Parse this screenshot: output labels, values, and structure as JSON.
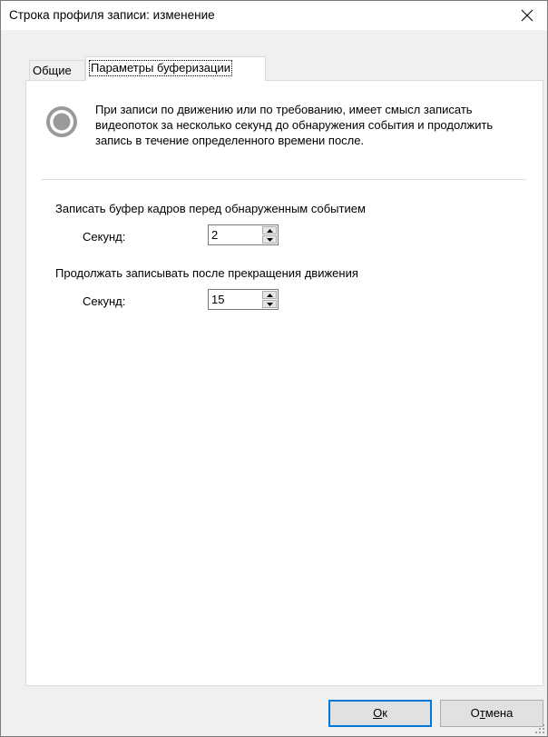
{
  "window": {
    "title": "Строка профиля записи: изменение",
    "close_icon": "close-icon"
  },
  "tabs": [
    {
      "label": "Общие",
      "active": false
    },
    {
      "label": "Параметры буферизации",
      "active": true
    }
  ],
  "info": {
    "icon": "radio-record-icon",
    "text": "При записи по движению или по требованию, имеет смысл записать видеопоток за несколько секунд до обнаружения события и продолжить запись в течение определенного времени после."
  },
  "pre_buffer": {
    "section_label": "Записать буфер кадров перед обнаруженным событием",
    "field_label": "Секунд:",
    "value": "2"
  },
  "post_buffer": {
    "section_label": "Продолжать записывать после прекращения движения",
    "field_label": "Секунд:",
    "value": "15"
  },
  "buttons": {
    "ok_mnemonic": "О",
    "ok_rest": "к",
    "cancel_prefix": "О",
    "cancel_mnemonic": "т",
    "cancel_rest": "мена"
  },
  "colors": {
    "accent": "#0078d7",
    "window_bg": "#f0f0f0",
    "panel_bg": "#ffffff"
  }
}
